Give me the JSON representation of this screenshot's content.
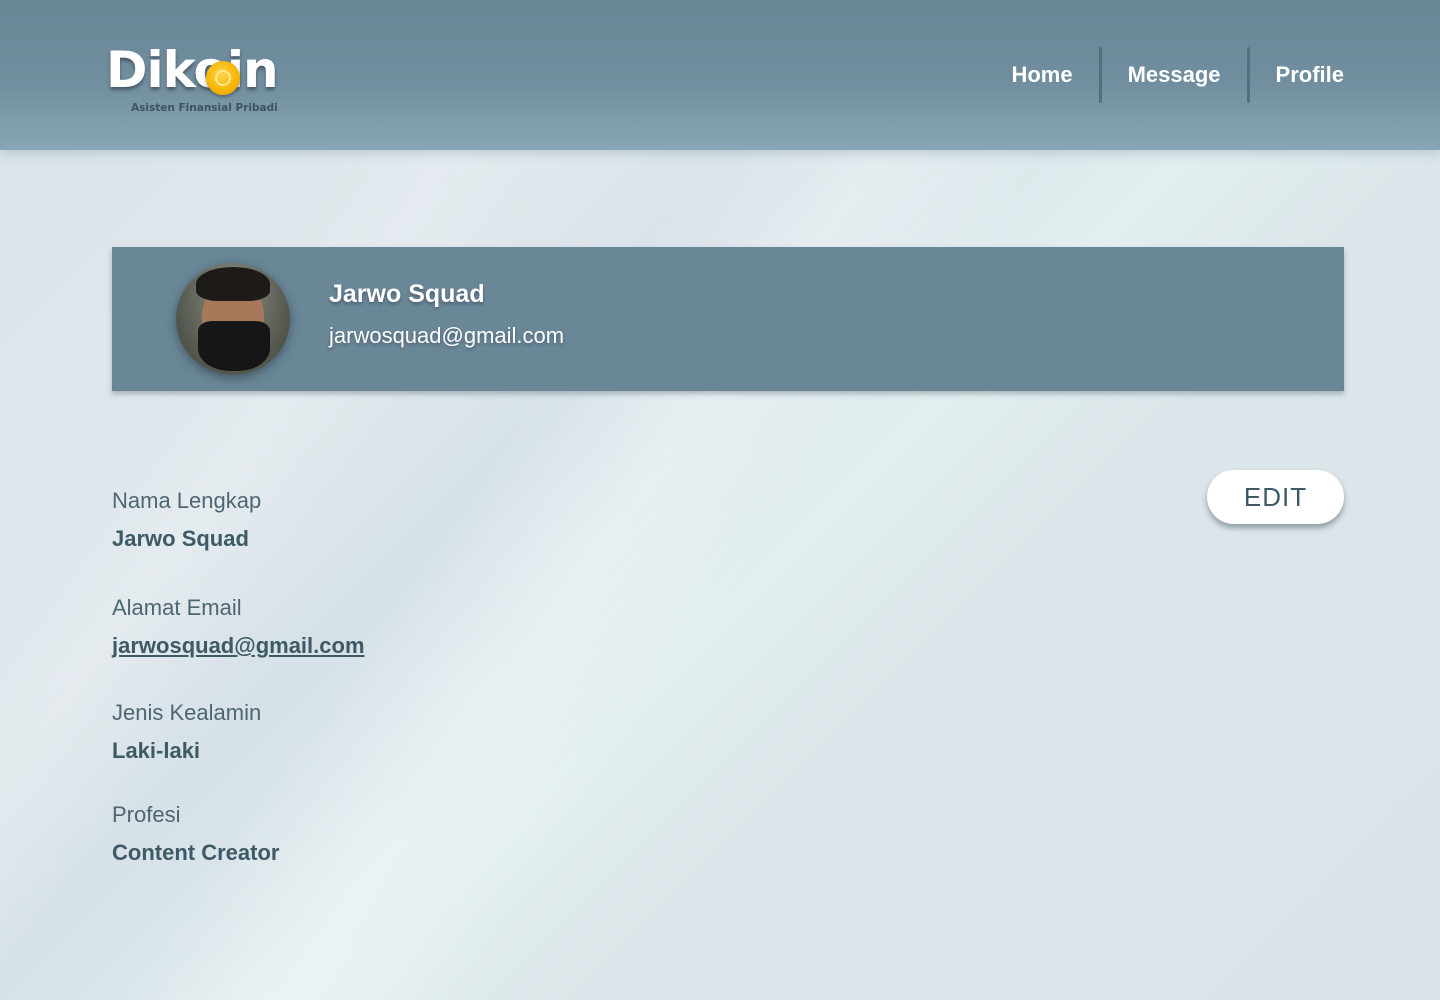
{
  "header": {
    "logo": {
      "word": "Dikoin",
      "tagline": "Asisten Finansial Pribadi",
      "coin_color": "#f5b400"
    },
    "nav": [
      {
        "label": "Home"
      },
      {
        "label": "Message"
      },
      {
        "label": "Profile"
      }
    ],
    "background_color": "#6a8798"
  },
  "profile_card": {
    "name": "Jarwo Squad",
    "email": "jarwosquad@gmail.com",
    "avatar_icon": "user-photo-avatar",
    "background_color": "#6a8798"
  },
  "details": {
    "full_name": {
      "label": "Nama Lengkap",
      "value": "Jarwo Squad"
    },
    "email": {
      "label": "Alamat Email",
      "value": "jarwosquad@gmail.com"
    },
    "gender": {
      "label": "Jenis Kealamin",
      "value": "Laki-laki"
    },
    "profession": {
      "label": "Profesi",
      "value": "Content Creator"
    }
  },
  "actions": {
    "edit_label": "EDIT"
  },
  "colors": {
    "text_primary": "#3d5a66",
    "page_background": "#dbe4ea"
  }
}
